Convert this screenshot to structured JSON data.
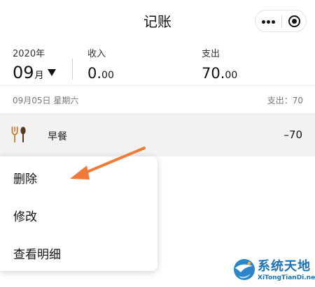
{
  "header": {
    "title": "记账"
  },
  "summary": {
    "year": "2020年",
    "month_num": "09",
    "month_unit": "月",
    "income_label": "收入",
    "income_int": "0.",
    "income_dec": "00",
    "expense_label": "支出",
    "expense_int": "70.",
    "expense_dec": "00"
  },
  "day": {
    "date": "09月05日 星期六",
    "total": "支出：70"
  },
  "record": {
    "icon": "fork-spoon-icon",
    "name": "早餐",
    "amount": "–70"
  },
  "context_menu": {
    "delete": "删除",
    "edit": "修改",
    "details": "查看明细"
  },
  "watermark": {
    "title": "系统天地",
    "url": "XiTongTianDi.net"
  },
  "colors": {
    "arrow": "#f07a36",
    "watermark": "#1b73b6",
    "item_bg": "#f2f2f2"
  }
}
